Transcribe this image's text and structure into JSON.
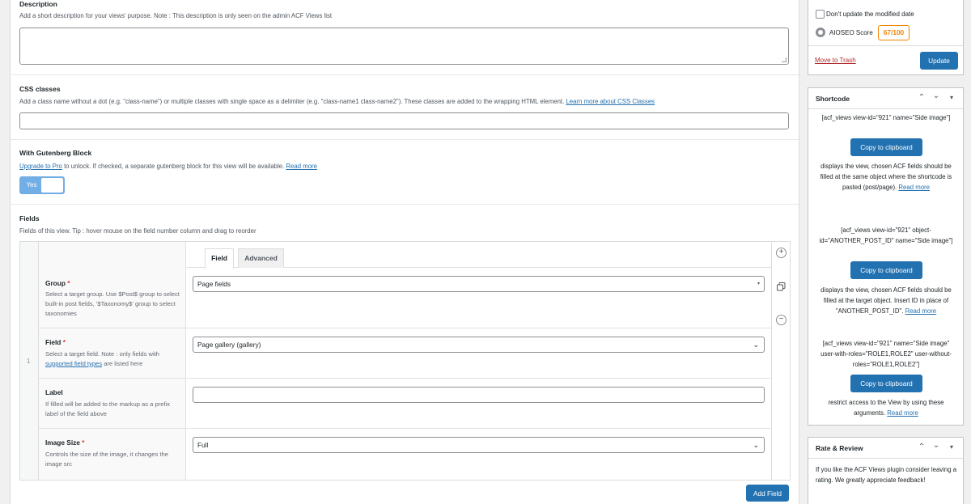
{
  "description": {
    "title": "Description",
    "help": "Add a short description for your views' purpose. Note : This description is only seen on the admin ACF Views list",
    "value": ""
  },
  "css_classes": {
    "title": "CSS classes",
    "help": "Add a class name without a dot (e.g. \"class-name\") or multiple classes with single space as a delimiter (e.g. \"class-name1 class-name2\"). These classes are added to the wrapping HTML element.",
    "link": "Learn more about CSS Classes",
    "value": ""
  },
  "gutenberg": {
    "title": "With Gutenberg Block",
    "upgrade_link": "Upgrade to Pro",
    "help": "to unlock. If checked, a separate gutenberg block for this view will be available.",
    "read_more": "Read more",
    "toggle_label": "Yes"
  },
  "fields": {
    "title": "Fields",
    "help": "Fields of this view. Tip : hover mouse on the field number column and drag to reorder",
    "row_number": "1",
    "tabs": [
      "Field",
      "Advanced"
    ],
    "group": {
      "label": "Group",
      "required": "*",
      "help": "Select a target group. Use $Post$ group to select built-in post fields, '$Taxonomy$' group to select taxonomies",
      "value": "Page fields"
    },
    "field": {
      "label": "Field",
      "required": "*",
      "help_prefix": "Select a target field. Note : only fields with",
      "help_link": "supported field types",
      "help_suffix": "are listed here",
      "value": "Page gallery (gallery)"
    },
    "label_field": {
      "label": "Label",
      "help": "If filled will be added to the markup as a prefix label of the field above",
      "value": ""
    },
    "image_size": {
      "label": "Image Size",
      "required": "*",
      "help": "Controls the size of the image, it changes the image src",
      "value": "Full"
    },
    "add_button": "Add Field"
  },
  "publish": {
    "dont_update_label": "Don't update the modified date",
    "aioseo_label": "AIOSEO Score",
    "aioseo_score": "67/100",
    "trash_label": "Move to Trash",
    "update_label": "Update"
  },
  "shortcode": {
    "title": "Shortcode",
    "items": [
      {
        "code": "[acf_views view-id=\"921\" name=\"Side image\"]",
        "button": "Copy to clipboard",
        "desc": "displays the view, chosen ACF fields should be filled at the same object where the shortcode is pasted (post/page).",
        "more": "Read more"
      },
      {
        "code": "[acf_views view-id=\"921\" object-id=\"ANOTHER_POST_ID\" name=\"Side image\"]",
        "button": "Copy to clipboard",
        "desc": "displays the view, chosen ACF fields should be filled at the target object. Insert ID in place of \"ANOTHER_POST_ID\".",
        "more": "Read more"
      },
      {
        "code": "[acf_views view-id=\"921\" name=\"Side image\" user-with-roles=\"ROLE1,ROLE2\" user-without-roles=\"ROLE1,ROLE2\"]",
        "button": "Copy to clipboard",
        "desc": "restrict access to the View by using these arguments.",
        "more": "Read more"
      }
    ]
  },
  "rate": {
    "title": "Rate & Review",
    "text": "If you like the ACF Views plugin consider leaving a rating. We greatly appreciate feedback!"
  },
  "icons": {
    "up": "chevron-up-icon",
    "down": "chevron-down-icon",
    "toggle": "triangle-toggle-icon",
    "add": "plus-circle-icon",
    "duplicate": "duplicate-icon",
    "remove": "minus-circle-icon",
    "aioseo": "aioseo-gear-icon"
  },
  "colors": {
    "primary": "#2271b1",
    "score": "#f18200",
    "trash": "#b32d2e",
    "required": "#d63638"
  }
}
